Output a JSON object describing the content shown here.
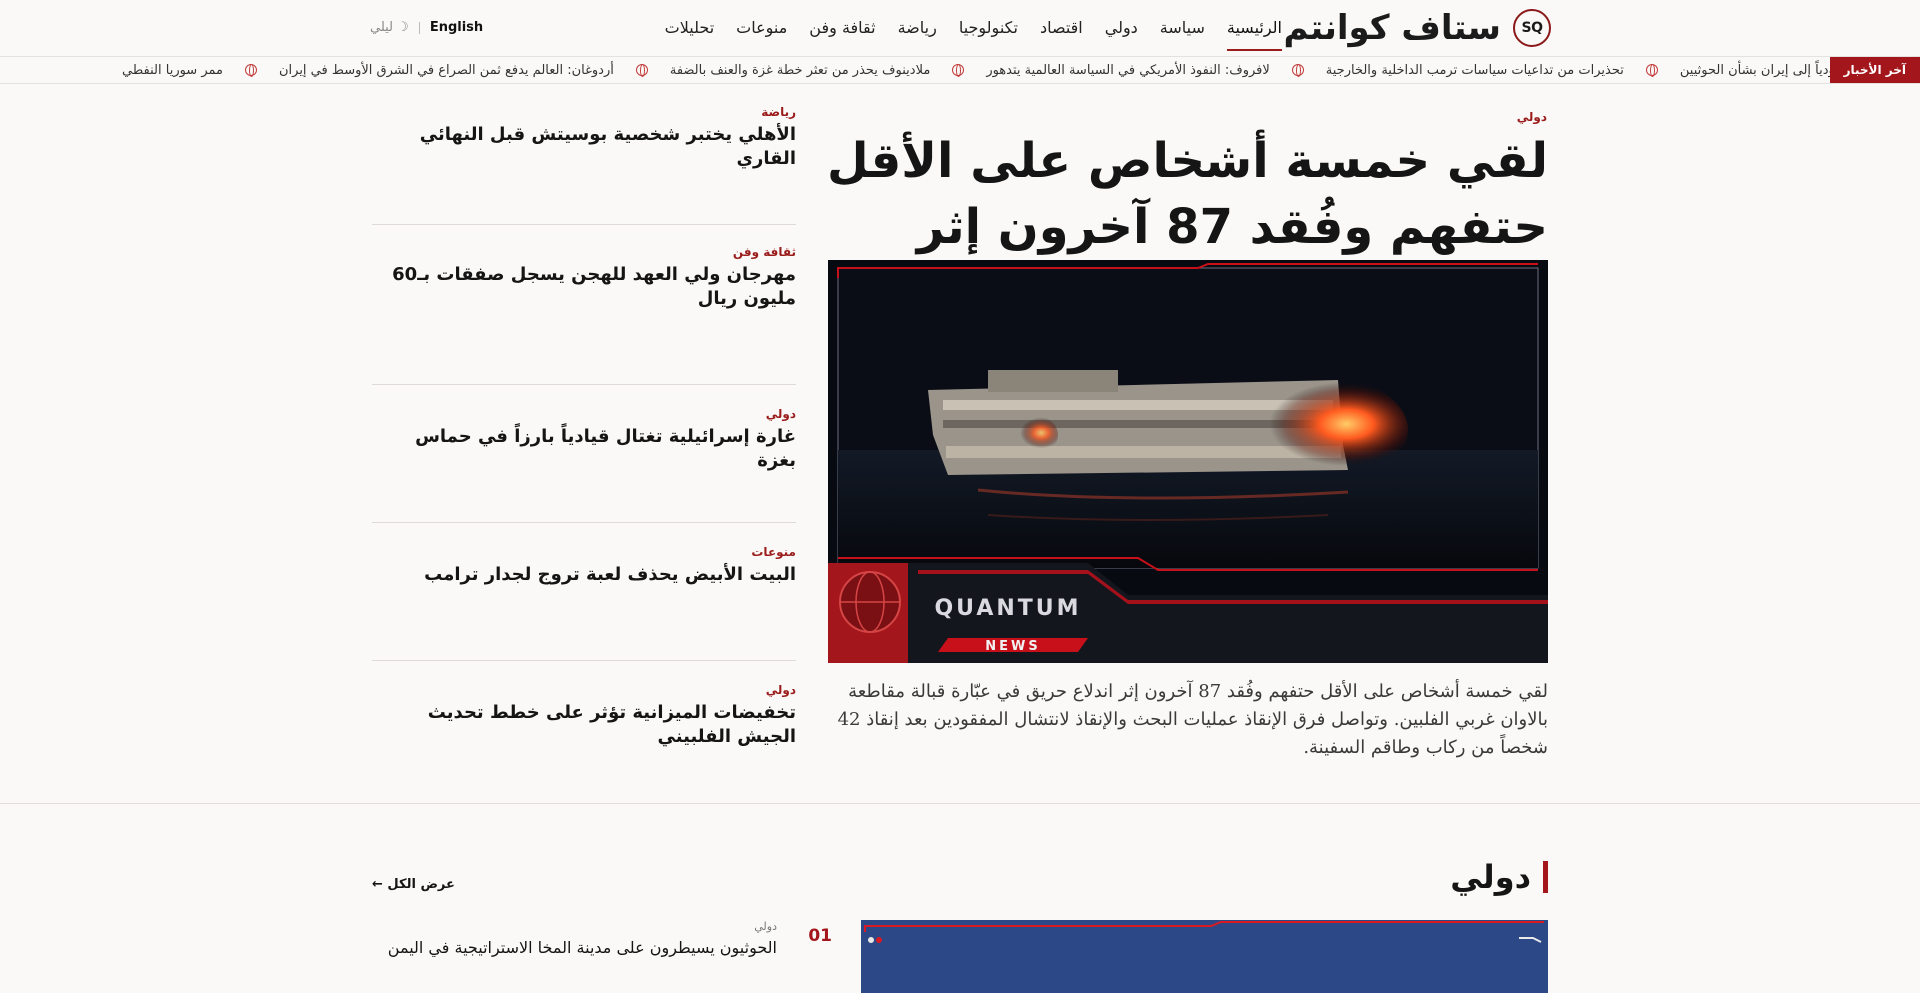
{
  "header": {
    "logo_badge": "SQ",
    "logo_text": "ستاف كوانتم",
    "nav": [
      "الرئيسية",
      "سياسة",
      "دولي",
      "اقتصاد",
      "تكنولوجيا",
      "رياضة",
      "ثقافة وفن",
      "منوعات",
      "تحليلات"
    ],
    "lang_label": "English",
    "night_label": "☽ ليلي"
  },
  "ticker": {
    "label": "آخر الأخبار",
    "items": [
      "عودياً إلى إيران بشأن الحوثيين",
      "تحذيرات من تداعيات سياسات ترمب الداخلية والخارجية",
      "لافروف: النفوذ الأمريكي في السياسة العالمية يتدهور",
      "ملادينوف يحذر من تعثر خطة غزة والعنف بالضفة",
      "أردوغان: العالم يدفع ثمن الصراع في الشرق الأوسط في إيران",
      "ممر سوريا النفطي"
    ]
  },
  "hero": {
    "category": "دولي",
    "title": "لقي خمسة أشخاص على الأقل حتفهم وفُقد 87 آخرون إثر",
    "image_caption_brand": "QUANTUM",
    "image_caption_sub": "NEWS",
    "description": "لقي خمسة أشخاص على الأقل حتفهم وفُقد 87 آخرون إثر اندلاع حريق في عبّارة قبالة مقاطعة بالاوان غربي الفلبين. وتواصل فرق الإنقاذ عمليات البحث والإنقاذ لانتشال المفقودين بعد إنقاذ 42 شخصاً من ركاب وطاقم السفينة."
  },
  "side": [
    {
      "category": "رياضة",
      "title": "الأهلي يختبر شخصية بوسيتش قبل النهائي القاري"
    },
    {
      "category": "ثقافة وفن",
      "title": "مهرجان ولي العهد للهجن يسجل صفقات بـ60 مليون ريال"
    },
    {
      "category": "دولي",
      "title": "غارة إسرائيلية تغتال قيادياً بارزاً في حماس بغزة"
    },
    {
      "category": "منوعات",
      "title": "البيت الأبيض يحذف لعبة تروج لجدار ترامب"
    },
    {
      "category": "دولي",
      "title": "تخفيضات الميزانية تؤثر على خطط تحديث الجيش الفلبيني"
    }
  ],
  "section": {
    "title": "دولي",
    "see_all": "عرض الكل ←",
    "items": [
      {
        "num": "01",
        "category": "دولي",
        "title": "الحوثيون يسيطرون على مدينة المخا الاستراتيجية في اليمن"
      }
    ]
  },
  "colors": {
    "accent": "#a3161b",
    "background": "#faf9f7",
    "text": "#151515"
  }
}
